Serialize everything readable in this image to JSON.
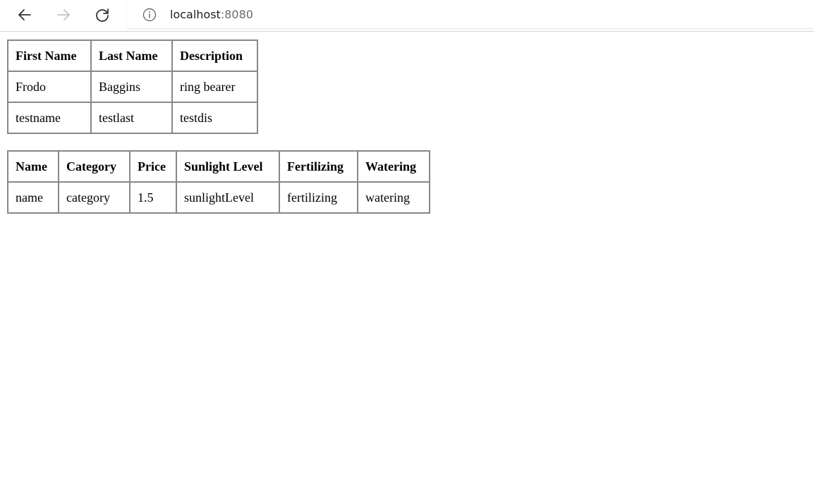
{
  "browser": {
    "url_host": "localhost",
    "url_port": ":8080"
  },
  "people_table": {
    "headers": [
      "First Name",
      "Last Name",
      "Description"
    ],
    "rows": [
      [
        "Frodo",
        "Baggins",
        "ring bearer"
      ],
      [
        "testname",
        "testlast",
        "testdis"
      ]
    ]
  },
  "plants_table": {
    "headers": [
      "Name",
      "Category",
      "Price",
      "Sunlight Level",
      "Fertilizing",
      "Watering"
    ],
    "rows": [
      [
        "name",
        "category",
        "1.5",
        "sunlightLevel",
        "fertilizing",
        "watering"
      ]
    ]
  }
}
